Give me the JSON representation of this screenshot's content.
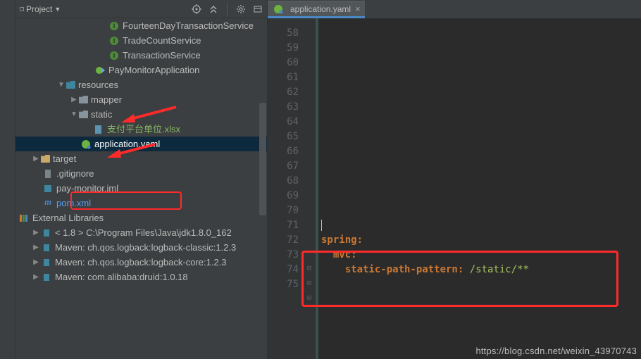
{
  "panel": {
    "title": "Project"
  },
  "tree": {
    "service1": "FourteenDayTransactionService",
    "service2": "TradeCountService",
    "service3": "TransactionService",
    "app": "PayMonitorApplication",
    "resources": "resources",
    "mapper": "mapper",
    "static": "static",
    "xlsx": "支付平台单位.xlsx",
    "yaml": "application.yaml",
    "target": "target",
    "gitignore": ".gitignore",
    "iml": "pay-monitor.iml",
    "pom": "pom.xml",
    "external": "External Libraries",
    "jdk_lib": "< 1.8 >",
    "jdk_path": "  C:\\Program Files\\Java\\jdk1.8.0_162",
    "maven1": "Maven: ch.qos.logback:logback-classic:1.2.3",
    "maven2": "Maven: ch.qos.logback:logback-core:1.2.3",
    "maven3": "Maven: com.alibaba:druid:1.0.18"
  },
  "tab": {
    "label": "application.yaml"
  },
  "gutter": [
    "58",
    "59",
    "60",
    "61",
    "62",
    "63",
    "64",
    "65",
    "66",
    "67",
    "68",
    "69",
    "70",
    "71",
    "72",
    "73",
    "74",
    "75"
  ],
  "code": {
    "spring": "spring:",
    "mvc": "mvc:",
    "spp_key": "static-path-pattern:",
    "spp_val": " /static/**"
  },
  "watermark": "https://blog.csdn.net/weixin_43970743"
}
